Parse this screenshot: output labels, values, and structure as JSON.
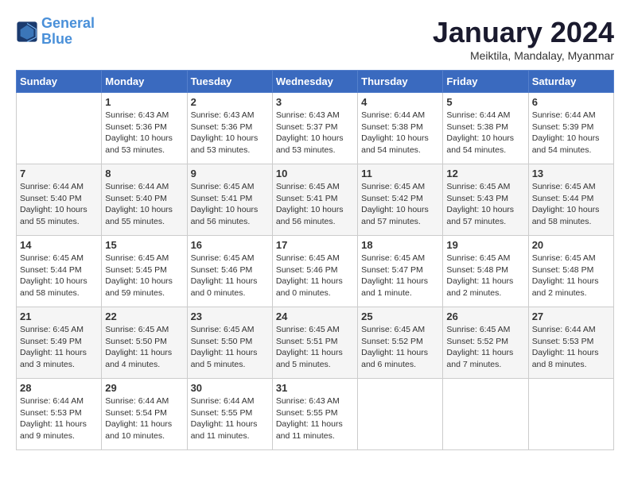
{
  "logo": {
    "line1": "General",
    "line2": "Blue"
  },
  "title": "January 2024",
  "location": "Meiktila, Mandalay, Myanmar",
  "weekdays": [
    "Sunday",
    "Monday",
    "Tuesday",
    "Wednesday",
    "Thursday",
    "Friday",
    "Saturday"
  ],
  "weeks": [
    [
      {
        "day": "",
        "info": ""
      },
      {
        "day": "1",
        "info": "Sunrise: 6:43 AM\nSunset: 5:36 PM\nDaylight: 10 hours\nand 53 minutes."
      },
      {
        "day": "2",
        "info": "Sunrise: 6:43 AM\nSunset: 5:36 PM\nDaylight: 10 hours\nand 53 minutes."
      },
      {
        "day": "3",
        "info": "Sunrise: 6:43 AM\nSunset: 5:37 PM\nDaylight: 10 hours\nand 53 minutes."
      },
      {
        "day": "4",
        "info": "Sunrise: 6:44 AM\nSunset: 5:38 PM\nDaylight: 10 hours\nand 54 minutes."
      },
      {
        "day": "5",
        "info": "Sunrise: 6:44 AM\nSunset: 5:38 PM\nDaylight: 10 hours\nand 54 minutes."
      },
      {
        "day": "6",
        "info": "Sunrise: 6:44 AM\nSunset: 5:39 PM\nDaylight: 10 hours\nand 54 minutes."
      }
    ],
    [
      {
        "day": "7",
        "info": "Sunrise: 6:44 AM\nSunset: 5:40 PM\nDaylight: 10 hours\nand 55 minutes."
      },
      {
        "day": "8",
        "info": "Sunrise: 6:44 AM\nSunset: 5:40 PM\nDaylight: 10 hours\nand 55 minutes."
      },
      {
        "day": "9",
        "info": "Sunrise: 6:45 AM\nSunset: 5:41 PM\nDaylight: 10 hours\nand 56 minutes."
      },
      {
        "day": "10",
        "info": "Sunrise: 6:45 AM\nSunset: 5:41 PM\nDaylight: 10 hours\nand 56 minutes."
      },
      {
        "day": "11",
        "info": "Sunrise: 6:45 AM\nSunset: 5:42 PM\nDaylight: 10 hours\nand 57 minutes."
      },
      {
        "day": "12",
        "info": "Sunrise: 6:45 AM\nSunset: 5:43 PM\nDaylight: 10 hours\nand 57 minutes."
      },
      {
        "day": "13",
        "info": "Sunrise: 6:45 AM\nSunset: 5:44 PM\nDaylight: 10 hours\nand 58 minutes."
      }
    ],
    [
      {
        "day": "14",
        "info": "Sunrise: 6:45 AM\nSunset: 5:44 PM\nDaylight: 10 hours\nand 58 minutes."
      },
      {
        "day": "15",
        "info": "Sunrise: 6:45 AM\nSunset: 5:45 PM\nDaylight: 10 hours\nand 59 minutes."
      },
      {
        "day": "16",
        "info": "Sunrise: 6:45 AM\nSunset: 5:46 PM\nDaylight: 11 hours\nand 0 minutes."
      },
      {
        "day": "17",
        "info": "Sunrise: 6:45 AM\nSunset: 5:46 PM\nDaylight: 11 hours\nand 0 minutes."
      },
      {
        "day": "18",
        "info": "Sunrise: 6:45 AM\nSunset: 5:47 PM\nDaylight: 11 hours\nand 1 minute."
      },
      {
        "day": "19",
        "info": "Sunrise: 6:45 AM\nSunset: 5:48 PM\nDaylight: 11 hours\nand 2 minutes."
      },
      {
        "day": "20",
        "info": "Sunrise: 6:45 AM\nSunset: 5:48 PM\nDaylight: 11 hours\nand 2 minutes."
      }
    ],
    [
      {
        "day": "21",
        "info": "Sunrise: 6:45 AM\nSunset: 5:49 PM\nDaylight: 11 hours\nand 3 minutes."
      },
      {
        "day": "22",
        "info": "Sunrise: 6:45 AM\nSunset: 5:50 PM\nDaylight: 11 hours\nand 4 minutes."
      },
      {
        "day": "23",
        "info": "Sunrise: 6:45 AM\nSunset: 5:50 PM\nDaylight: 11 hours\nand 5 minutes."
      },
      {
        "day": "24",
        "info": "Sunrise: 6:45 AM\nSunset: 5:51 PM\nDaylight: 11 hours\nand 5 minutes."
      },
      {
        "day": "25",
        "info": "Sunrise: 6:45 AM\nSunset: 5:52 PM\nDaylight: 11 hours\nand 6 minutes."
      },
      {
        "day": "26",
        "info": "Sunrise: 6:45 AM\nSunset: 5:52 PM\nDaylight: 11 hours\nand 7 minutes."
      },
      {
        "day": "27",
        "info": "Sunrise: 6:44 AM\nSunset: 5:53 PM\nDaylight: 11 hours\nand 8 minutes."
      }
    ],
    [
      {
        "day": "28",
        "info": "Sunrise: 6:44 AM\nSunset: 5:53 PM\nDaylight: 11 hours\nand 9 minutes."
      },
      {
        "day": "29",
        "info": "Sunrise: 6:44 AM\nSunset: 5:54 PM\nDaylight: 11 hours\nand 10 minutes."
      },
      {
        "day": "30",
        "info": "Sunrise: 6:44 AM\nSunset: 5:55 PM\nDaylight: 11 hours\nand 11 minutes."
      },
      {
        "day": "31",
        "info": "Sunrise: 6:43 AM\nSunset: 5:55 PM\nDaylight: 11 hours\nand 11 minutes."
      },
      {
        "day": "",
        "info": ""
      },
      {
        "day": "",
        "info": ""
      },
      {
        "day": "",
        "info": ""
      }
    ]
  ]
}
